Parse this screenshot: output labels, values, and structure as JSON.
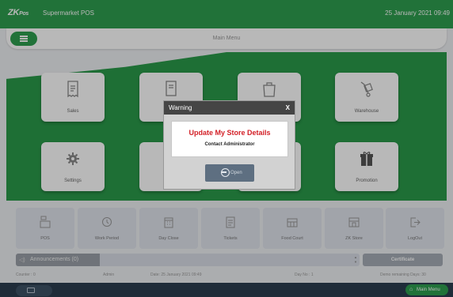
{
  "header": {
    "logo": "ZK",
    "logo_suffix": "Pos",
    "app_title": "Supermarket POS",
    "datetime": "25 January 2021 09:49"
  },
  "menubar": {
    "title": "Main Menu"
  },
  "tiles": [
    {
      "label": "Sales",
      "icon": "receipt-icon"
    },
    {
      "label": "",
      "icon": "report-icon"
    },
    {
      "label": "",
      "icon": "shop-bag-icon"
    },
    {
      "label": "Warehouse",
      "icon": "trolley-icon"
    },
    {
      "label": "Settings",
      "icon": "gear-icon"
    },
    {
      "label": "",
      "icon": "blank"
    },
    {
      "label": "",
      "icon": "blank"
    },
    {
      "label": "Promotion",
      "icon": "gift-icon"
    }
  ],
  "shortcuts": [
    {
      "label": "POS",
      "icon": "cash-register-icon"
    },
    {
      "label": "Work Period",
      "icon": "clock-icon"
    },
    {
      "label": "Day Close",
      "icon": "calendar-icon"
    },
    {
      "label": "Tickets",
      "icon": "ticket-icon"
    },
    {
      "label": "Food Court",
      "icon": "food-court-icon"
    },
    {
      "label": "ZK Store",
      "icon": "store-icon"
    },
    {
      "label": "LogOut",
      "icon": "logout-icon"
    }
  ],
  "announcements": {
    "label": "Announcements (0)"
  },
  "certificate_label": "Certificate",
  "status": {
    "counter": "Counter : 0",
    "user": "Admin",
    "date": "Date: 25 January 2021 09:49",
    "day": "Day No : 1",
    "demo": "Demo remaining Days: 30"
  },
  "bottom": {
    "main_menu": "Main Menu"
  },
  "dialog": {
    "title": "Warning",
    "close": "X",
    "message": "Update My Store Details",
    "submessage": "Contact Administrator",
    "button": "Open"
  },
  "colors": {
    "brand_green": "#2e9e4f",
    "warning_red": "#d32027",
    "dialog_header": "#454545",
    "bottom_bar": "#2c3e50"
  }
}
